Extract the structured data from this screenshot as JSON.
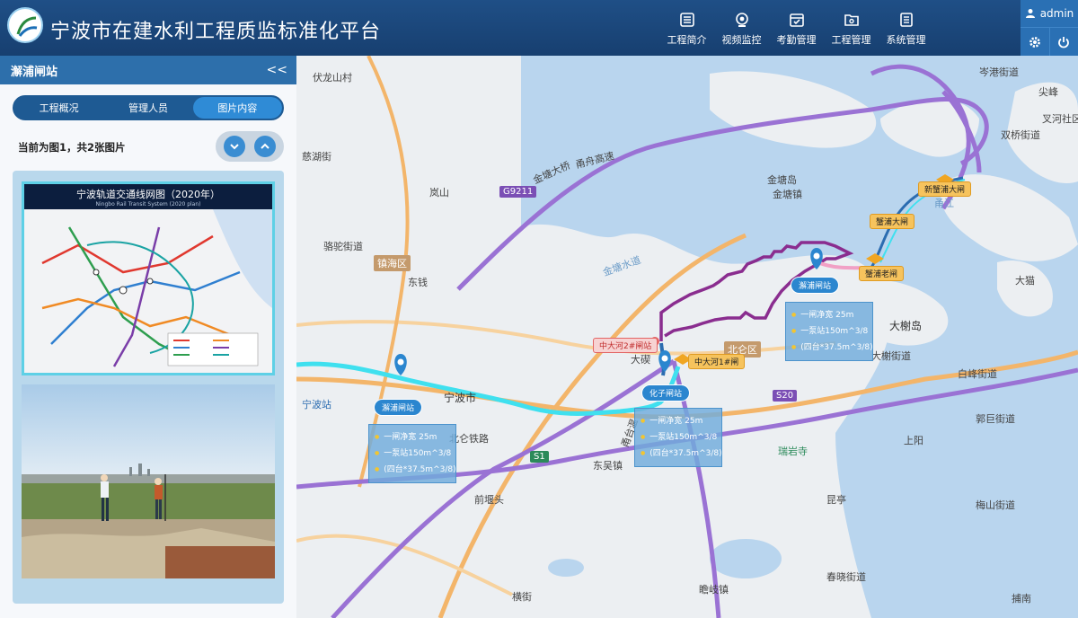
{
  "header": {
    "title": "宁波市在建水利工程质监标准化平台",
    "nav": [
      {
        "label": "工程简介",
        "icon": "list-icon"
      },
      {
        "label": "视频监控",
        "icon": "camera-icon"
      },
      {
        "label": "考勤管理",
        "icon": "calendar-check-icon"
      },
      {
        "label": "工程管理",
        "icon": "folder-gear-icon"
      },
      {
        "label": "系统管理",
        "icon": "document-list-icon"
      }
    ],
    "user": "admin"
  },
  "sidebar": {
    "title": "澥浦闸站",
    "collapse": "<<",
    "tabs": [
      "工程概况",
      "管理人员",
      "图片内容"
    ],
    "active_tab": 2,
    "image_info": "当前为图1，共2张图片",
    "images": {
      "transit_title": "宁波轨道交通线网图（2020年）",
      "transit_subtitle": "Ningbo Rail Transit System (2020 plan)"
    }
  },
  "map": {
    "places": [
      "伏龙山村",
      "岚山",
      "骆驼街道",
      "镇海区",
      "东钱",
      "大碶",
      "北仑区",
      "大榭岛",
      "大榭街道",
      "金塘岛",
      "金塘镇",
      "岑港街道",
      "尖峰",
      "双桥街道",
      "叉河社区",
      "大猫",
      "白峰街道",
      "郭巨街道",
      "上阳",
      "瑞岩寺",
      "梅山街道",
      "春晓街道",
      "昆亭",
      "瞻岐镇",
      "横街",
      "前堰头",
      "东吴镇",
      "宁波站",
      "北仑铁路",
      "慈湖街",
      "金塘大桥",
      "甬舟高速",
      "甬台温",
      "捕南",
      "宁波市"
    ],
    "roads": [
      "G9211",
      "S1",
      "S20"
    ],
    "water": [
      "金塘水道",
      "甬江"
    ],
    "stations": [
      {
        "name": "澥浦闸站",
        "info": [
          "一闸净宽 25m",
          "一泵站150m^3/8",
          "(四台*37.5m^3/8)"
        ]
      },
      {
        "name": "化子闸站",
        "info": [
          "一闸净宽 25m",
          "一泵站150m^3/8",
          "(四台*37.5m^3/8)"
        ]
      },
      {
        "name": "澥浦闸站",
        "info": [
          "一闸净宽 25m",
          "一泵站150m^3/8",
          "(四台*37.5m^3/8)"
        ]
      }
    ],
    "gates": [
      "新蟹浦大闸",
      "蟹浦大闸",
      "蟹浦老闸",
      "中大河1#闸",
      "中大河2#闸站"
    ],
    "colors": {
      "header": "#1f4f86",
      "accent": "#2f8bd6",
      "route_cyan": "#3fe0ef",
      "route_purple": "#8a2d8f",
      "route_pink": "#f1a0c5",
      "road_purple": "#9a72d4",
      "road_orange": "#f3b56a"
    }
  }
}
